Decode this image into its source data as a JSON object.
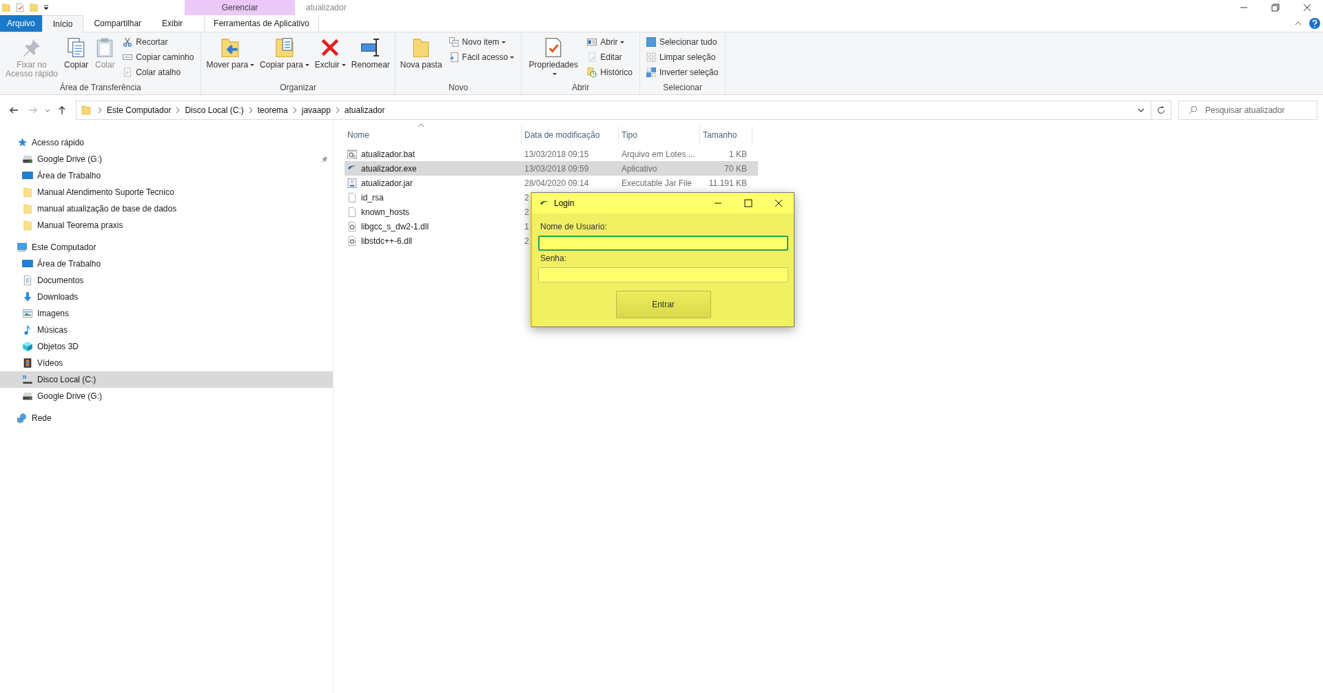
{
  "title_bar": {
    "context_header": "Gerenciar",
    "title": "atualizador"
  },
  "ribbon_tabs": [
    {
      "label": "Arquivo",
      "kind": "file",
      "selected": false
    },
    {
      "label": "Início",
      "kind": "tab",
      "selected": true
    },
    {
      "label": "Compartilhar",
      "kind": "tab",
      "selected": false
    },
    {
      "label": "Exibir",
      "kind": "tab",
      "selected": false
    },
    {
      "label": "Ferramentas de Aplicativo",
      "kind": "contextual",
      "selected": false
    }
  ],
  "ribbon_groups": [
    {
      "label": "Área de Transferência",
      "large": [
        {
          "label": "Fixar no Acesso rápido",
          "kind": "pin",
          "disabled": true,
          "dropdown": false
        },
        {
          "label": "Copiar",
          "kind": "copy",
          "disabled": false,
          "dropdown": false
        },
        {
          "label": "Colar",
          "kind": "paste",
          "disabled": true,
          "dropdown": false
        }
      ],
      "small": [
        {
          "label": "Recortar",
          "kind": "cut",
          "disabled": false,
          "dropdown": false
        },
        {
          "label": "Copiar caminho",
          "kind": "path",
          "disabled": false,
          "dropdown": false
        },
        {
          "label": "Colar atalho",
          "kind": "shortcut",
          "disabled": true,
          "dropdown": false
        }
      ]
    },
    {
      "label": "Organizar",
      "large": [
        {
          "label": "Mover para",
          "kind": "move",
          "disabled": false,
          "dropdown": true
        },
        {
          "label": "Copiar para",
          "kind": "copyto",
          "disabled": false,
          "dropdown": true
        },
        {
          "label": "Excluir",
          "kind": "delete",
          "disabled": false,
          "dropdown": true
        },
        {
          "label": "Renomear",
          "kind": "rename",
          "disabled": false,
          "dropdown": false
        }
      ]
    },
    {
      "label": "Novo",
      "large": [
        {
          "label": "Nova pasta",
          "kind": "newfolder",
          "disabled": false,
          "dropdown": false
        }
      ],
      "small": [
        {
          "label": "Novo item",
          "kind": "newitem",
          "disabled": false,
          "dropdown": true
        },
        {
          "label": "Fácil acesso",
          "kind": "easyaccess",
          "disabled": false,
          "dropdown": true
        }
      ]
    },
    {
      "label": "Abrir",
      "large": [
        {
          "label": "Propriedades",
          "kind": "properties",
          "disabled": false,
          "dropdown": true
        }
      ],
      "small": [
        {
          "label": "Abrir",
          "kind": "open",
          "disabled": false,
          "dropdown": true
        },
        {
          "label": "Editar",
          "kind": "edit",
          "disabled": true,
          "dropdown": false
        },
        {
          "label": "Histórico",
          "kind": "history",
          "disabled": false,
          "dropdown": false
        }
      ]
    },
    {
      "label": "Selecionar",
      "small": [
        {
          "label": "Selecionar tudo",
          "kind": "selectall",
          "disabled": false,
          "dropdown": false
        },
        {
          "label": "Limpar seleção",
          "kind": "selectnone",
          "disabled": false,
          "dropdown": false
        },
        {
          "label": "Inverter seleção",
          "kind": "invert",
          "disabled": false,
          "dropdown": false
        }
      ]
    }
  ],
  "address": {
    "breadcrumbs": [
      "Este Computador",
      "Disco Local (C:)",
      "teorema",
      "javaapp",
      "atualizador"
    ],
    "search": {
      "placeholder": "Pesquisar atualizador"
    }
  },
  "nav": [
    {
      "label": "Acesso rápido",
      "kind": "quickaccess",
      "selected": false,
      "children": [
        {
          "label": "Google Drive (G:)",
          "kind": "drive",
          "selected": false,
          "pinned": true
        },
        {
          "label": "Área de Trabalho",
          "kind": "desktop",
          "selected": false,
          "pinned": false
        },
        {
          "label": "Manual Atendimento Suporte Tecnico",
          "kind": "folder",
          "selected": false,
          "pinned": false
        },
        {
          "label": "manual atualização de base de dados",
          "kind": "folder",
          "selected": false,
          "pinned": false
        },
        {
          "label": "Manual Teorema praxis",
          "kind": "folder",
          "selected": false,
          "pinned": false
        }
      ]
    },
    {
      "label": "Este Computador",
      "kind": "computer",
      "selected": false,
      "children": [
        {
          "label": "Área de Trabalho",
          "kind": "desktop",
          "selected": false
        },
        {
          "label": "Documentos",
          "kind": "documents",
          "selected": false
        },
        {
          "label": "Downloads",
          "kind": "downloads",
          "selected": false
        },
        {
          "label": "Imagens",
          "kind": "pictures",
          "selected": false
        },
        {
          "label": "Músicas",
          "kind": "music",
          "selected": false
        },
        {
          "label": "Objetos 3D",
          "kind": "objects3d",
          "selected": false
        },
        {
          "label": "Vídeos",
          "kind": "videos",
          "selected": false
        },
        {
          "label": "Disco Local (C:)",
          "kind": "localdisk",
          "selected": true
        },
        {
          "label": "Google Drive (G:)",
          "kind": "drive",
          "selected": false
        }
      ]
    },
    {
      "label": "Rede",
      "kind": "network",
      "selected": false
    }
  ],
  "file_list": {
    "columns": [
      "Nome",
      "Data de modificação",
      "Tipo",
      "Tamanho"
    ],
    "rows": [
      {
        "name": "atualizador.bat",
        "kind": "batch",
        "date": "13/03/2018 09:15",
        "type": "Arquivo em Lotes ...",
        "size": "1 KB",
        "selected": false
      },
      {
        "name": "atualizador.exe",
        "kind": "app",
        "date": "13/03/2018 09:59",
        "type": "Aplicativo",
        "size": "70 KB",
        "selected": true
      },
      {
        "name": "atualizador.jar",
        "kind": "jar",
        "date": "28/04/2020 09:14",
        "type": "Executable Jar File",
        "size": "11.191 KB",
        "selected": false
      },
      {
        "name": "id_rsa",
        "kind": "file",
        "date": "2",
        "selected": false
      },
      {
        "name": "known_hosts",
        "kind": "file",
        "date": "2",
        "selected": false
      },
      {
        "name": "libgcc_s_dw2-1.dll",
        "kind": "dll",
        "date": "1",
        "selected": false
      },
      {
        "name": "libstdc++-6.dll",
        "kind": "dll",
        "date": "2",
        "selected": false
      }
    ]
  },
  "dialog": {
    "title": "Login",
    "fields": [
      {
        "label": "Nome de Usuario:",
        "focused": true
      },
      {
        "label": "Senha:",
        "focused": false
      }
    ],
    "button": "Entrar"
  }
}
